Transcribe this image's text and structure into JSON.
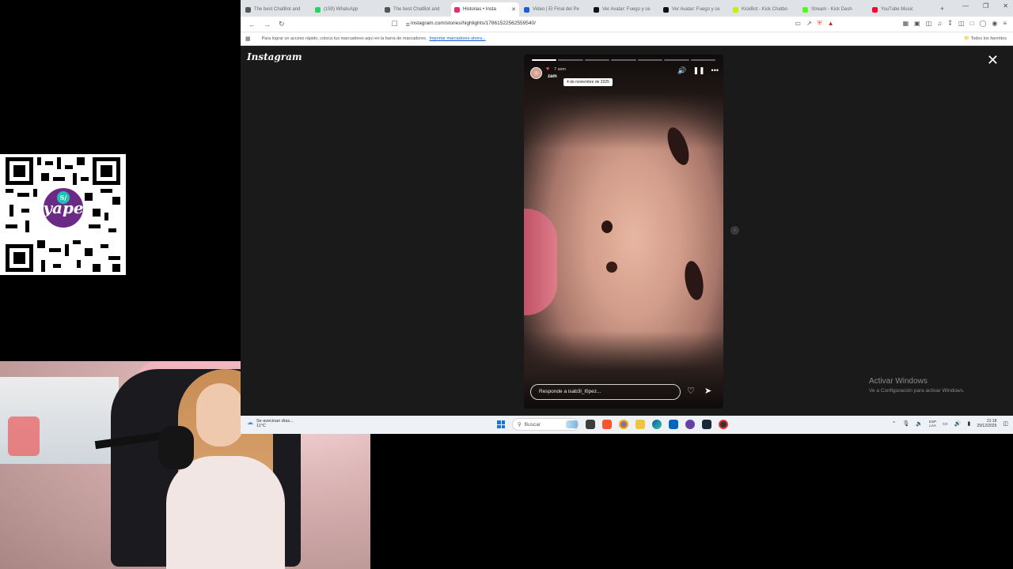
{
  "browser": {
    "tabs": [
      {
        "label": "The best ChatBot and",
        "color": "#555555",
        "active": false
      },
      {
        "label": "(159) WhatsApp",
        "color": "#25d366",
        "active": false
      },
      {
        "label": "The best ChatBot and",
        "color": "#555555",
        "active": false
      },
      {
        "label": "Historias • Insta",
        "color": "#e1306c",
        "active": true
      },
      {
        "label": "Video | El Final del Pe",
        "color": "#1a5fd0",
        "active": false
      },
      {
        "label": "Ver Avatar: Fuego y ce",
        "color": "#111111",
        "active": false
      },
      {
        "label": "Ver Avatar: Fuego y ce",
        "color": "#111111",
        "active": false
      },
      {
        "label": "KickBot - Kick Chatbo",
        "color": "#c6f000",
        "active": false
      },
      {
        "label": "Stream - Kick Dash",
        "color": "#53fc18",
        "active": false
      },
      {
        "label": "YouTube Music",
        "color": "#ff0033",
        "active": false
      }
    ],
    "url": "instagram.com/stories/highlights/17861522562559540/",
    "bookmarks_text": "Para lograr un acceso rápido, coloca tus marcadores aquí en la barra de marcadores.",
    "bookmarks_link": "Importar marcadores ahora...",
    "bookmarks_right": "Todos los favoritos"
  },
  "instagram": {
    "logo": "Instagram",
    "story": {
      "time": "7 sem",
      "username": "zam",
      "tooltip": "4 de noviembre de 2025",
      "reply_placeholder": "Responde a isab3l_l0pez..."
    }
  },
  "watermark": {
    "line1": "Activar Windows",
    "line2": "Ve a Configuración para activar Windows."
  },
  "taskbar": {
    "weather_line1": "Se avecinan días...",
    "weather_line2": "11°C",
    "search_label": "Buscar",
    "lang_line1": "ESP",
    "lang_line2": "LAA",
    "time": "21:18",
    "date": "29/12/2025"
  },
  "overlay": {
    "qr_badge": "yape",
    "qr_currency": "S/"
  }
}
